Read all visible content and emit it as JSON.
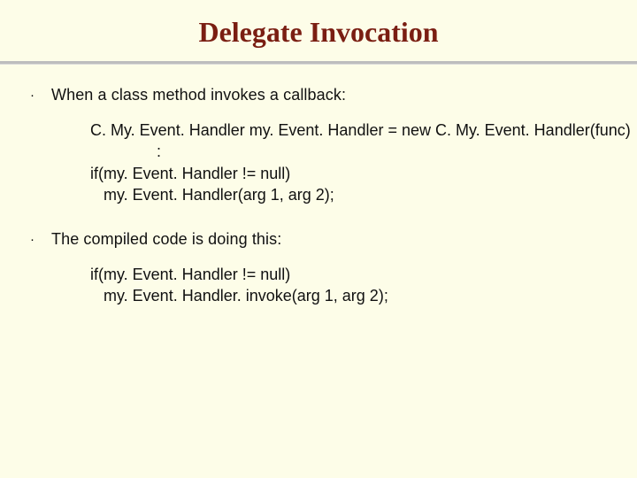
{
  "title": "Delegate Invocation",
  "bullets": [
    {
      "text": "When a class method invokes a callback:"
    },
    {
      "text": "The compiled code is doing this:"
    }
  ],
  "code_blocks": [
    "C. My. Event. Handler my. Event. Handler = new C. My. Event. Handler(func)\n               :\nif(my. Event. Handler != null)\n   my. Event. Handler(arg 1, arg 2);",
    "if(my. Event. Handler != null)\n   my. Event. Handler. invoke(arg 1, arg 2);"
  ],
  "bullet_glyph": "·"
}
